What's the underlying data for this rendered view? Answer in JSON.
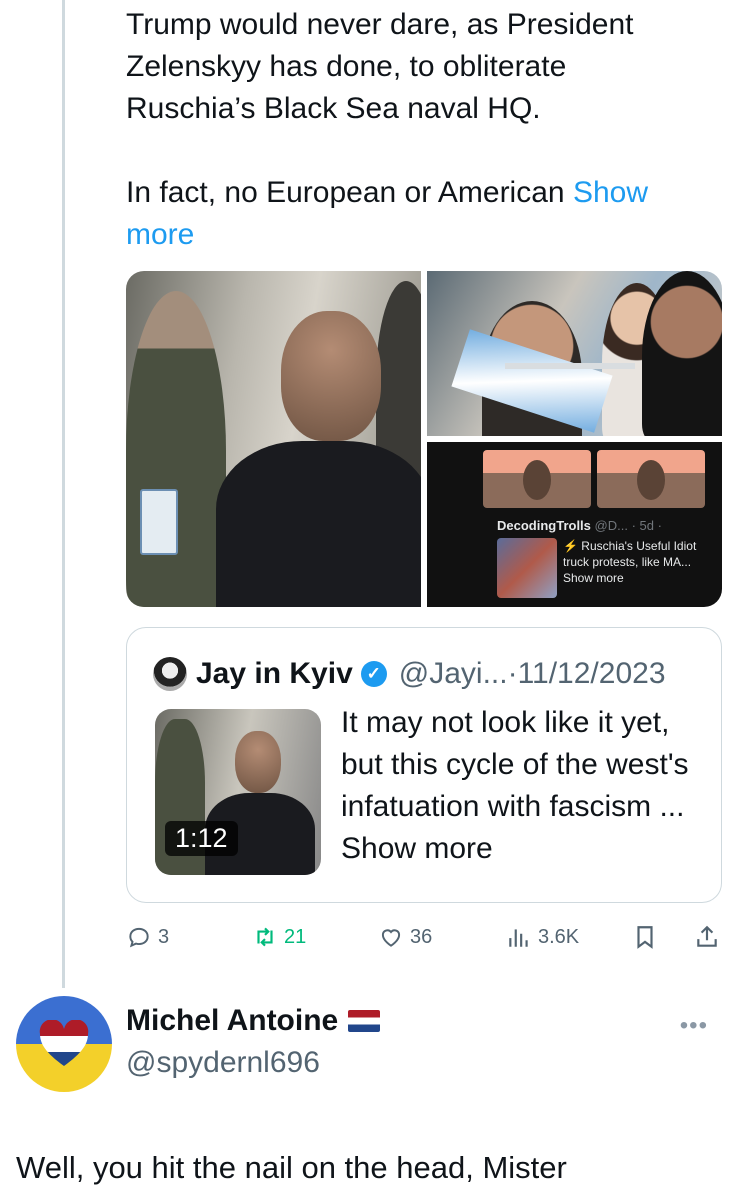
{
  "tweet": {
    "paragraph1": "Trump would never dare, as President\nZelenskyy has done, to obliterate\nRuschia’s Black Sea naval HQ.",
    "paragraph2": "In fact, no European or American ",
    "show_more": "Show\nmore"
  },
  "media": {
    "embedded_card": {
      "name": "DecodingTrolls",
      "handle_time": "@D... · 5d ·",
      "text": "⚡ Ruschia's Useful Idiot truck protests, like MA... Show more"
    }
  },
  "quote": {
    "name": "Jay in Kyiv",
    "handle": "@Jayi...",
    "separator": "·",
    "date": "11/12/2023",
    "video_duration": "1:12",
    "text": "It may not look like it yet, but this cycle of the west's infatuation with fascism ... Show more"
  },
  "actions": {
    "replies": "3",
    "retweets": "21",
    "likes": "36",
    "views": "3.6K",
    "retweet_color": "#00ba7c"
  },
  "reply": {
    "author_name": "Michel Antoine",
    "author_handle": "@spydernl696",
    "more_icon": "more-dots-icon",
    "text": "Well, you hit the nail on the head, Mister"
  },
  "colors": {
    "accent": "#1d9bf0",
    "muted": "#536471"
  }
}
